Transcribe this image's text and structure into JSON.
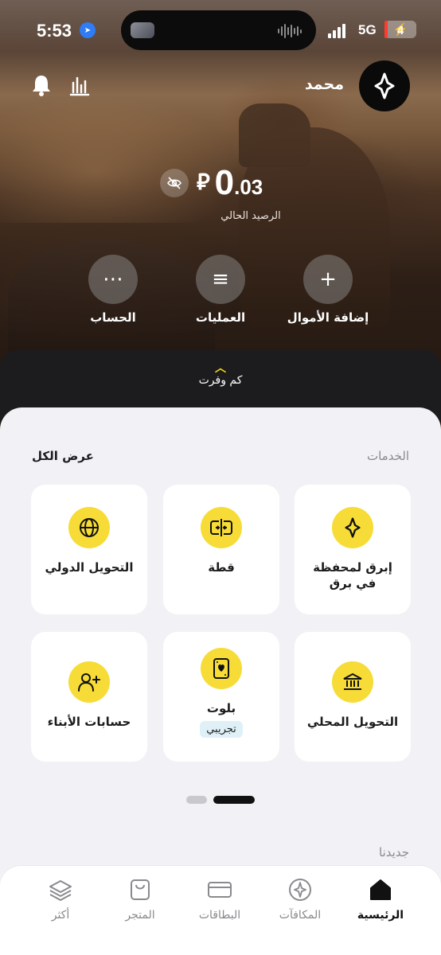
{
  "status_bar": {
    "time": "5:53",
    "network": "5G",
    "battery": "4",
    "battery_level_percent": 4,
    "battery_color": "#ff3b30"
  },
  "header": {
    "user_name": "محمد",
    "icons": [
      "app-logo-icon",
      "bell-icon",
      "stats-icon"
    ]
  },
  "balance": {
    "currency_symbol": "⃁",
    "integer": "0",
    "decimal": ".03",
    "label": "الرصيد الحالي"
  },
  "quick_actions": [
    {
      "id": "add-funds",
      "icon": "+",
      "label": "إضافة الأموال"
    },
    {
      "id": "transactions",
      "icon": "≡",
      "label": "العمليات"
    },
    {
      "id": "account",
      "icon": "⋯",
      "label": "الحساب"
    }
  ],
  "savings": {
    "label": "كم وفرت"
  },
  "services": {
    "title": "الخدمات",
    "view_all": "عرض الكل",
    "items": [
      {
        "label": "إبرق لمحفظة في برق",
        "icon": "sparkle-icon"
      },
      {
        "label": "قطة",
        "icon": "split-icon"
      },
      {
        "label": "التحويل الدولي",
        "icon": "globe-icon"
      },
      {
        "label": "التحويل المحلي",
        "icon": "bank-icon"
      },
      {
        "label": "بلوت",
        "icon": "playing-card-icon",
        "badge": "تجريبي"
      },
      {
        "label": "حسابات الأبناء",
        "icon": "add-user-icon"
      }
    ]
  },
  "new_section": {
    "title": "جديدنا"
  },
  "tab_bar": [
    {
      "label": "الرئيسية",
      "icon": "home-icon",
      "active": true
    },
    {
      "label": "المكافآت",
      "icon": "compass-icon",
      "active": false
    },
    {
      "label": "البطاقات",
      "icon": "card-icon",
      "active": false
    },
    {
      "label": "المتجر",
      "icon": "bag-icon",
      "active": false
    },
    {
      "label": "أكثر",
      "icon": "layers-icon",
      "active": false
    }
  ],
  "colors": {
    "accent_yellow": "#f7dc37",
    "sheet_bg": "#f2f2f6",
    "dark": "#111111"
  }
}
